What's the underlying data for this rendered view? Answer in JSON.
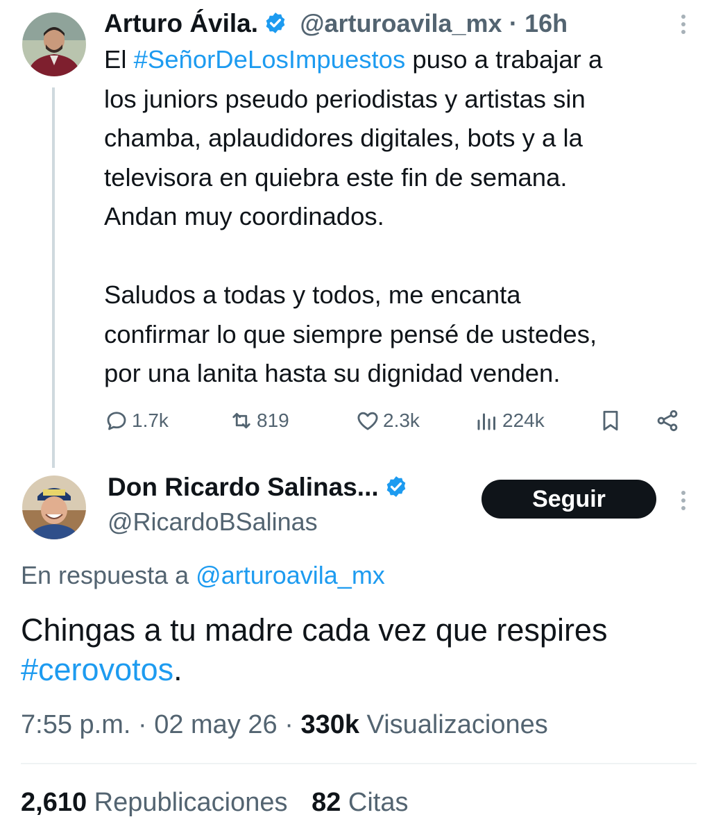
{
  "parent_tweet": {
    "author_name": "Arturo Ávila.",
    "handle": "@arturoavila_mx",
    "separator": "·",
    "time": "16h",
    "text_pre": "El ",
    "hashtag": "#SeñorDeLosImpuestos",
    "text_post": " puso a trabajar a\nlos juniors pseudo periodistas y artistas sin\nchamba, aplaudidores digitales, bots y a la\ntelevisora en quiebra este fin de semana.\nAndan muy coordinados.\n\nSaludos a todas y todos, me encanta\nconfirmar lo que siempre pensé de ustedes,\npor una lanita hasta su dignidad venden.",
    "replies": "1.7k",
    "reposts": "819",
    "likes": "2.3k",
    "views": "224k"
  },
  "main_tweet": {
    "author_name": "Don Ricardo Salinas...",
    "handle": "@RicardoBSalinas",
    "follow_label": "Seguir",
    "reply_prefix": "En respuesta a ",
    "reply_handle": "@arturoavila_mx",
    "text": "Chingas a tu madre cada vez que respires\n",
    "hashtag": "#cerovotos",
    "text_end": ".",
    "time": "7:55 p.m.",
    "date": "02 may 26",
    "views_count": "330k",
    "views_label": "Visualizaciones",
    "reposts_count": "2,610",
    "reposts_label": "Republicaciones",
    "quotes_count": "82",
    "quotes_label": "Citas"
  },
  "colors": {
    "accent": "#1d9bf0",
    "text": "#0f1419",
    "muted": "#536471",
    "verified": "#1d9bf0"
  },
  "icons": [
    "reply-icon",
    "repost-icon",
    "like-icon",
    "views-icon",
    "bookmark-icon",
    "share-icon",
    "more-icon",
    "verified-badge-icon"
  ]
}
